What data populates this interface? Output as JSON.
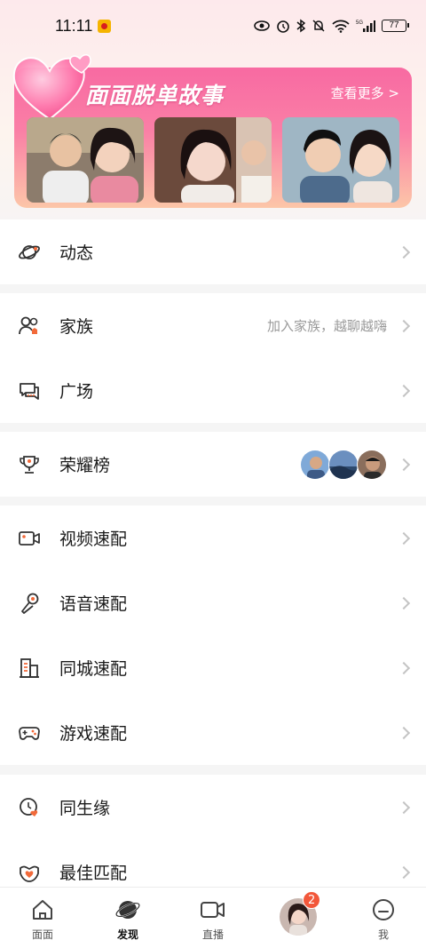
{
  "status_bar": {
    "time": "11:11",
    "network": "5G",
    "battery": "77"
  },
  "banner": {
    "title": "面面脱单故事",
    "more_label": "查看更多 >"
  },
  "menu": {
    "moments": {
      "label": "动态"
    },
    "family": {
      "label": "家族",
      "hint": "加入家族，越聊越嗨"
    },
    "square": {
      "label": "广场"
    },
    "leaderboard": {
      "label": "荣耀榜"
    },
    "video_match": {
      "label": "视频速配"
    },
    "voice_match": {
      "label": "语音速配"
    },
    "city_match": {
      "label": "同城速配"
    },
    "game_match": {
      "label": "游戏速配"
    },
    "same_birth": {
      "label": "同生缘"
    },
    "best_match": {
      "label": "最佳匹配"
    }
  },
  "bottom_nav": {
    "items": [
      {
        "label": "面面",
        "icon": "home-icon"
      },
      {
        "label": "发现",
        "icon": "planet-icon"
      },
      {
        "label": "直播",
        "icon": "video-camera-icon"
      },
      {
        "label": "",
        "icon": "message-avatar"
      },
      {
        "label": "我",
        "icon": "me-icon"
      }
    ],
    "badge_count": "2",
    "active": "发现"
  },
  "colors": {
    "accent_pink": "#f86aa2",
    "badge_red": "#f2573a",
    "icon_orange": "#f26a3a"
  }
}
